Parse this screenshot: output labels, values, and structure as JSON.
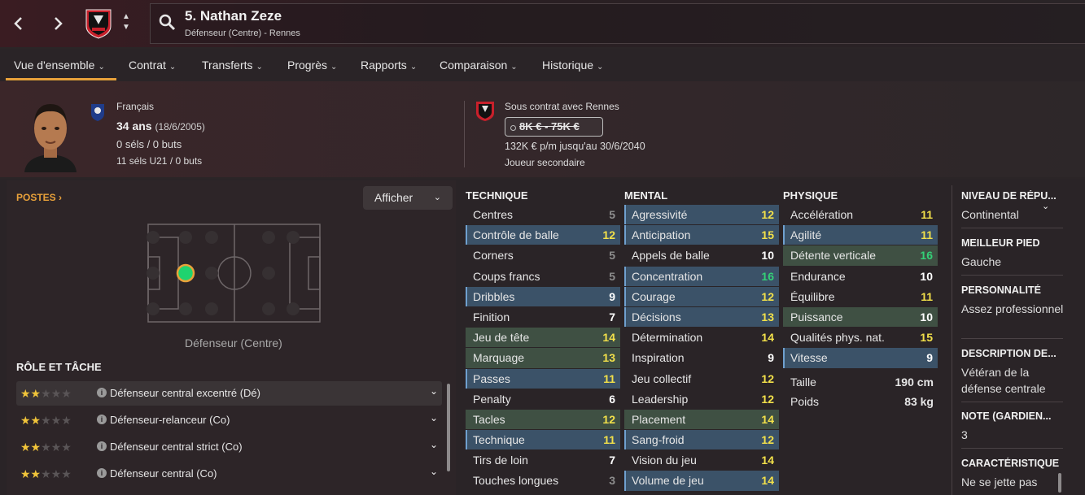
{
  "header": {
    "title": "5. Nathan Zeze",
    "subtitle": "Défenseur (Centre) - Rennes",
    "back_icon": "chevron-left-icon",
    "forward_icon": "chevron-right-icon"
  },
  "tabs": [
    {
      "label": "Vue d'ensemble"
    },
    {
      "label": "Contrat"
    },
    {
      "label": "Transferts"
    },
    {
      "label": "Progrès"
    },
    {
      "label": "Rapports"
    },
    {
      "label": "Comparaison"
    },
    {
      "label": "Historique"
    }
  ],
  "profile": {
    "nationality": "Français",
    "age": "34 ans",
    "birth": "(18/6/2005)",
    "caps": "0 séls / 0 buts",
    "u21": "11 séls U21 / 0 buts",
    "contract_club": "Sous contrat avec Rennes",
    "value": "8K € - 75K €",
    "wage": "132K € p/m jusqu'au 30/6/2040",
    "status": "Joueur secondaire"
  },
  "positions": {
    "title": "POSTES",
    "show_button": "Afficher",
    "position_label": "Défenseur (Centre)"
  },
  "roles": {
    "title": "RÔLE ET TÂCHE",
    "items": [
      {
        "label": "Défenseur central excentré (Dé)",
        "stars": 2
      },
      {
        "label": "Défenseur-relanceur (Co)",
        "stars": 2
      },
      {
        "label": "Défenseur central strict (Co)",
        "stars": 2
      },
      {
        "label": "Défenseur central (Co)",
        "stars": 2
      }
    ]
  },
  "technique": {
    "title": "TECHNIQUE",
    "items": [
      {
        "name": "Centres",
        "value": "5"
      },
      {
        "name": "Contrôle de balle",
        "value": "12"
      },
      {
        "name": "Corners",
        "value": "5"
      },
      {
        "name": "Coups francs",
        "value": "5"
      },
      {
        "name": "Dribbles",
        "value": "9"
      },
      {
        "name": "Finition",
        "value": "7"
      },
      {
        "name": "Jeu de tête",
        "value": "14"
      },
      {
        "name": "Marquage",
        "value": "13"
      },
      {
        "name": "Passes",
        "value": "11"
      },
      {
        "name": "Penalty",
        "value": "6"
      },
      {
        "name": "Tacles",
        "value": "12"
      },
      {
        "name": "Technique",
        "value": "11"
      },
      {
        "name": "Tirs de loin",
        "value": "7"
      },
      {
        "name": "Touches longues",
        "value": "3"
      }
    ]
  },
  "mental": {
    "title": "MENTAL",
    "items": [
      {
        "name": "Agressivité",
        "value": "12"
      },
      {
        "name": "Anticipation",
        "value": "15"
      },
      {
        "name": "Appels de balle",
        "value": "10"
      },
      {
        "name": "Concentration",
        "value": "16"
      },
      {
        "name": "Courage",
        "value": "12"
      },
      {
        "name": "Décisions",
        "value": "13"
      },
      {
        "name": "Détermination",
        "value": "14"
      },
      {
        "name": "Inspiration",
        "value": "9"
      },
      {
        "name": "Jeu collectif",
        "value": "12"
      },
      {
        "name": "Leadership",
        "value": "12"
      },
      {
        "name": "Placement",
        "value": "14"
      },
      {
        "name": "Sang-froid",
        "value": "12"
      },
      {
        "name": "Vision du jeu",
        "value": "14"
      },
      {
        "name": "Volume de jeu",
        "value": "14"
      }
    ]
  },
  "physique": {
    "title": "PHYSIQUE",
    "items": [
      {
        "name": "Accélération",
        "value": "11"
      },
      {
        "name": "Agilité",
        "value": "11"
      },
      {
        "name": "Détente verticale",
        "value": "16"
      },
      {
        "name": "Endurance",
        "value": "10"
      },
      {
        "name": "Équilibre",
        "value": "11"
      },
      {
        "name": "Puissance",
        "value": "10"
      },
      {
        "name": "Qualités phys. nat.",
        "value": "15"
      },
      {
        "name": "Vitesse",
        "value": "9"
      }
    ],
    "height_label": "Taille",
    "height": "190 cm",
    "weight_label": "Poids",
    "weight": "83 kg"
  },
  "sidebar": {
    "reputation_label": "NIVEAU DE RÉPU...",
    "reputation": "Continental",
    "foot_label": "MEILLEUR PIED",
    "foot": "Gauche",
    "personality_label": "PERSONNALITÉ",
    "personality": "Assez professionnel",
    "description_label": "DESCRIPTION DE...",
    "description": "Vétéran de la défense centrale",
    "rating_label": "NOTE (GARDIEN...",
    "rating": "3",
    "trait_label": "CARACTÉRISTIQUE",
    "trait": "Ne se jette pas"
  },
  "colors": {
    "accent": "#e8a13a",
    "highlight_row": "#3b5268",
    "key_row": "#3f5043",
    "high_value": "#34d077",
    "mid_value": "#f2e04a"
  }
}
